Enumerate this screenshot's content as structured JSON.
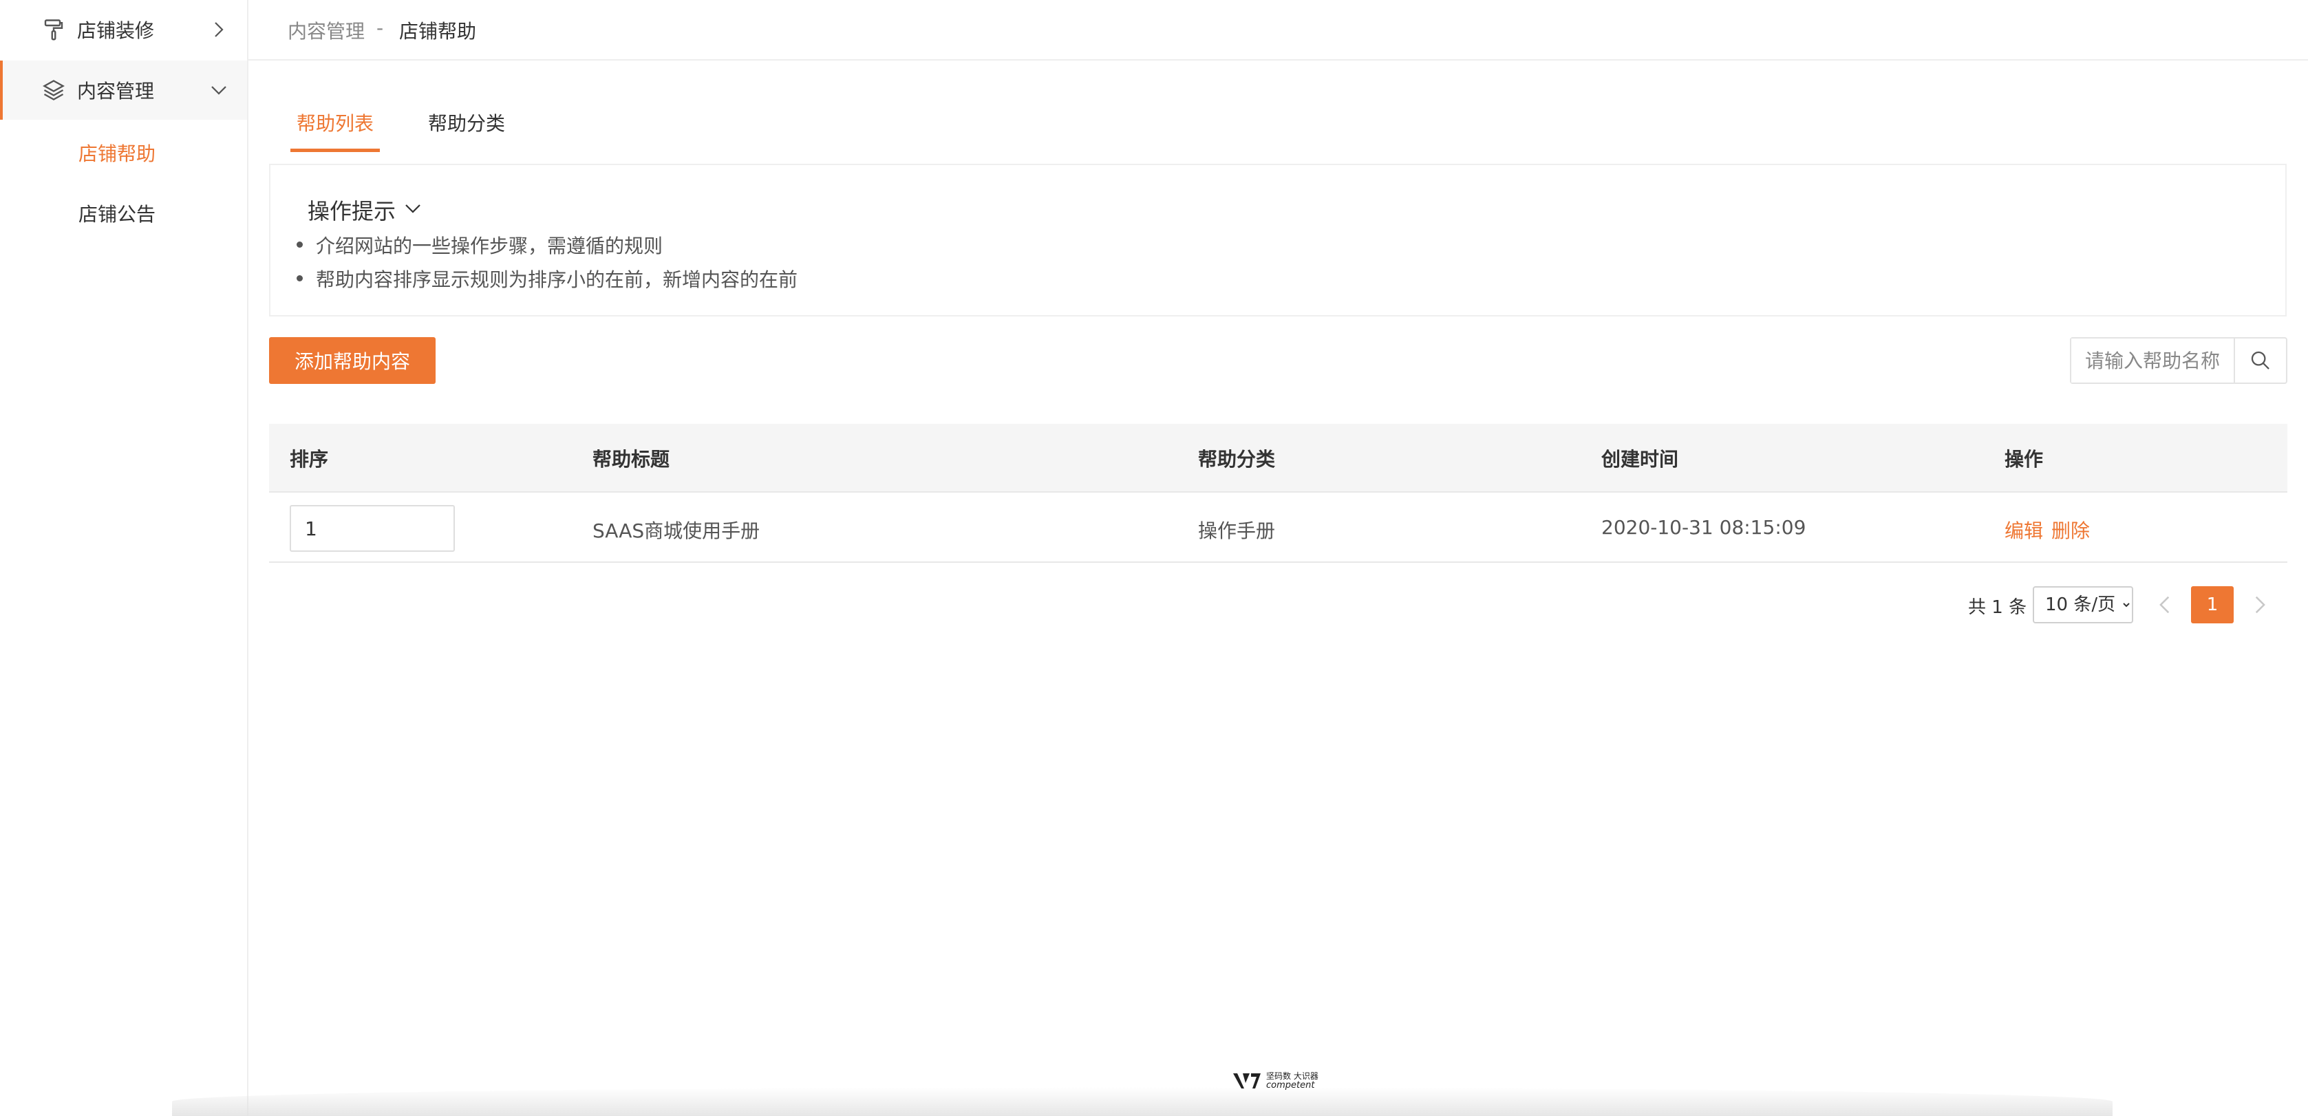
{
  "sidebar": {
    "groups": [
      {
        "label": "店铺装修",
        "icon": "paint-roller-icon"
      },
      {
        "label": "内容管理",
        "icon": "layers-icon"
      }
    ],
    "sub_items": [
      {
        "label": "店铺帮助",
        "active": true
      },
      {
        "label": "店铺公告",
        "active": false
      }
    ]
  },
  "breadcrumb": {
    "parent": "内容管理",
    "separator": "-",
    "current": "店铺帮助"
  },
  "tabs": [
    {
      "label": "帮助列表",
      "active": true
    },
    {
      "label": "帮助分类",
      "active": false
    }
  ],
  "tips": {
    "title": "操作提示",
    "items": [
      "介绍网站的一些操作步骤，需遵循的规则",
      "帮助内容排序显示规则为排序小的在前，新增内容的在前"
    ]
  },
  "toolbar": {
    "add_label": "添加帮助内容"
  },
  "search": {
    "placeholder": "请输入帮助名称"
  },
  "table": {
    "headers": [
      "排序",
      "帮助标题",
      "帮助分类",
      "创建时间",
      "操作"
    ],
    "rows": [
      {
        "sort": "1",
        "title": "SAAS商城使用手册",
        "category": "操作手册",
        "created": "2020-10-31 08:15:09",
        "actions": [
          "编辑",
          "删除"
        ]
      }
    ]
  },
  "pagination": {
    "total": "共 1 条",
    "page_size": "10 条/页",
    "current_page": "1"
  },
  "footer": {
    "brand_cn": "坚码数 大识器",
    "brand_en": "competent"
  },
  "colors": {
    "accent": "#ee7733",
    "header_bg": "#f5f5f5",
    "border": "#e8e8e8"
  }
}
